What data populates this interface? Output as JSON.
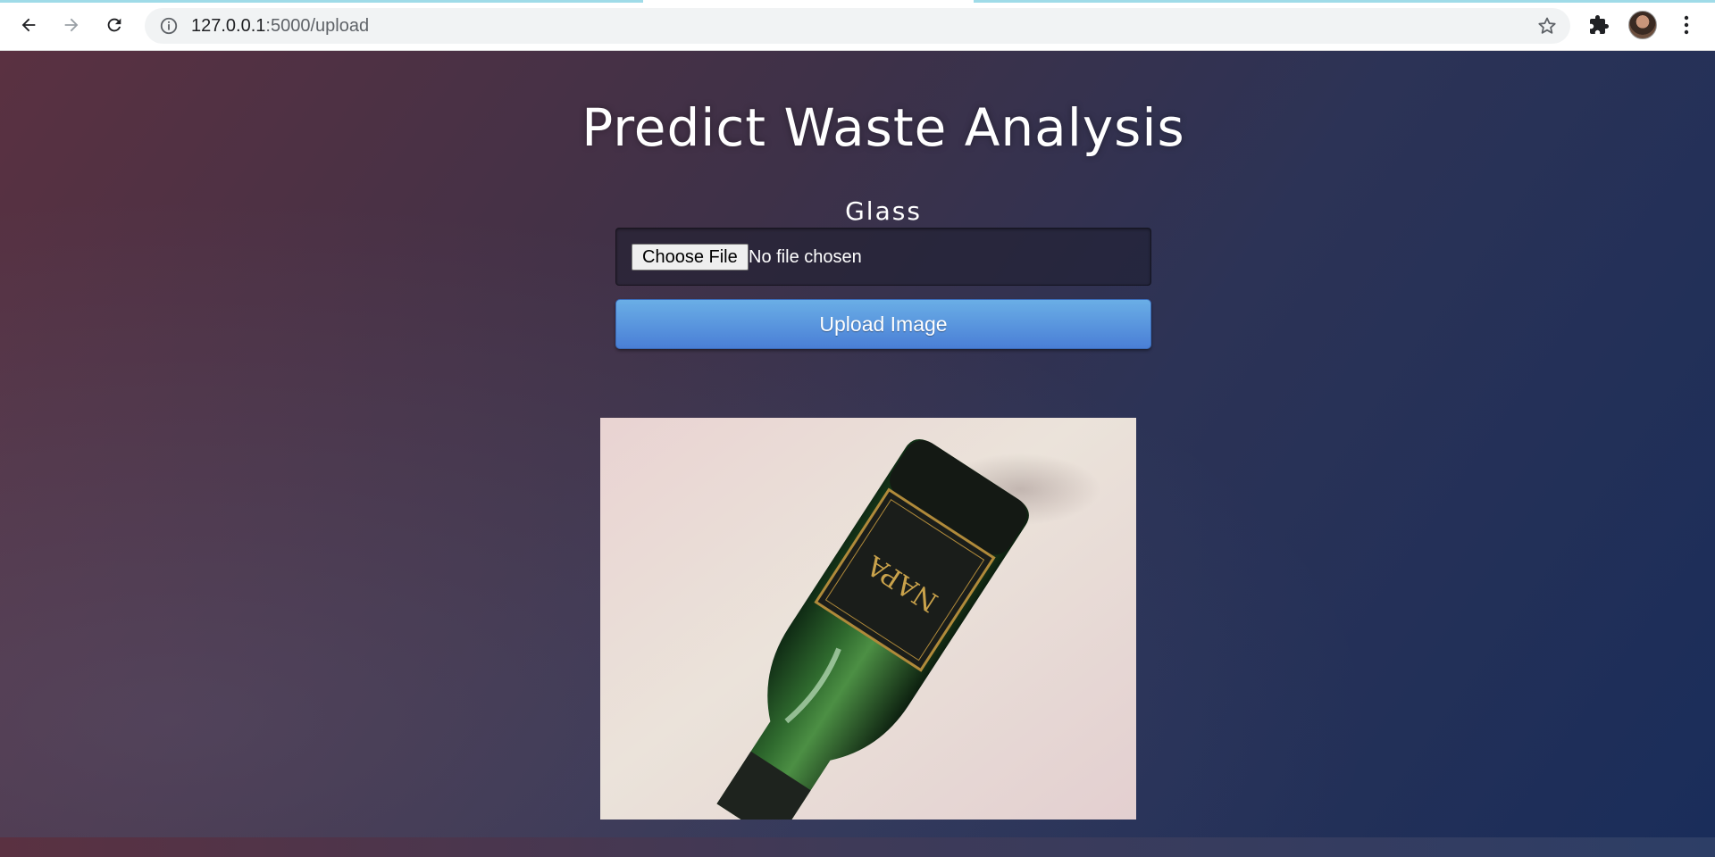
{
  "browser": {
    "url_host": "127.0.0.1",
    "url_path": ":5000/upload",
    "icons": {
      "back": "back-arrow-icon",
      "forward": "forward-arrow-icon",
      "reload": "reload-icon",
      "info": "info-icon",
      "bookmark": "star-icon",
      "extensions": "puzzle-icon",
      "menu": "kebab-menu-icon"
    }
  },
  "page": {
    "title": "Predict Waste Analysis",
    "result": "Glass",
    "file_input": {
      "button_label": "Choose File",
      "status": "No file chosen"
    },
    "upload_button": "Upload Image",
    "preview_image": {
      "labels": [
        "NAPA"
      ]
    }
  },
  "colors": {
    "upload_button": "#4f86d9",
    "background_start": "#5a3141",
    "background_end": "#1a2d5a"
  }
}
